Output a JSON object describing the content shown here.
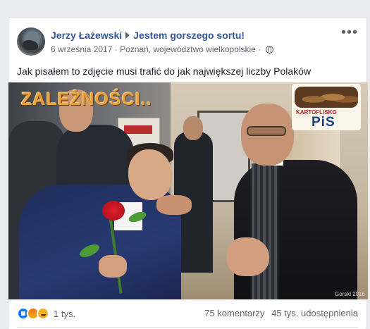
{
  "post": {
    "author": "Jerzy Łażewski",
    "target": "Jestem gorszego sortu!",
    "date": "6 września 2017",
    "location": "Poznań, województwo wielkopolskie",
    "separator": "·",
    "text": "Jak pisałem to zdjęcie musi trafić do jak największej liczby Polaków",
    "more_icon": "more-horizontal-icon",
    "privacy_icon": "globe-icon"
  },
  "image": {
    "overlay_title": "ZALEŻNOŚCI..",
    "logo_top": "KARTOFLISKO",
    "logo_bottom": "PiS",
    "watermark": "Gorski 2016"
  },
  "footer": {
    "reactions": [
      "like-icon",
      "angry-icon",
      "haha-icon"
    ],
    "reaction_count": "1 tys.",
    "comments": "75 komentarzy",
    "shares": "45 tys. udostępnienia"
  },
  "colors": {
    "link": "#365899",
    "meta": "#616770",
    "background": "#e9ebee"
  }
}
